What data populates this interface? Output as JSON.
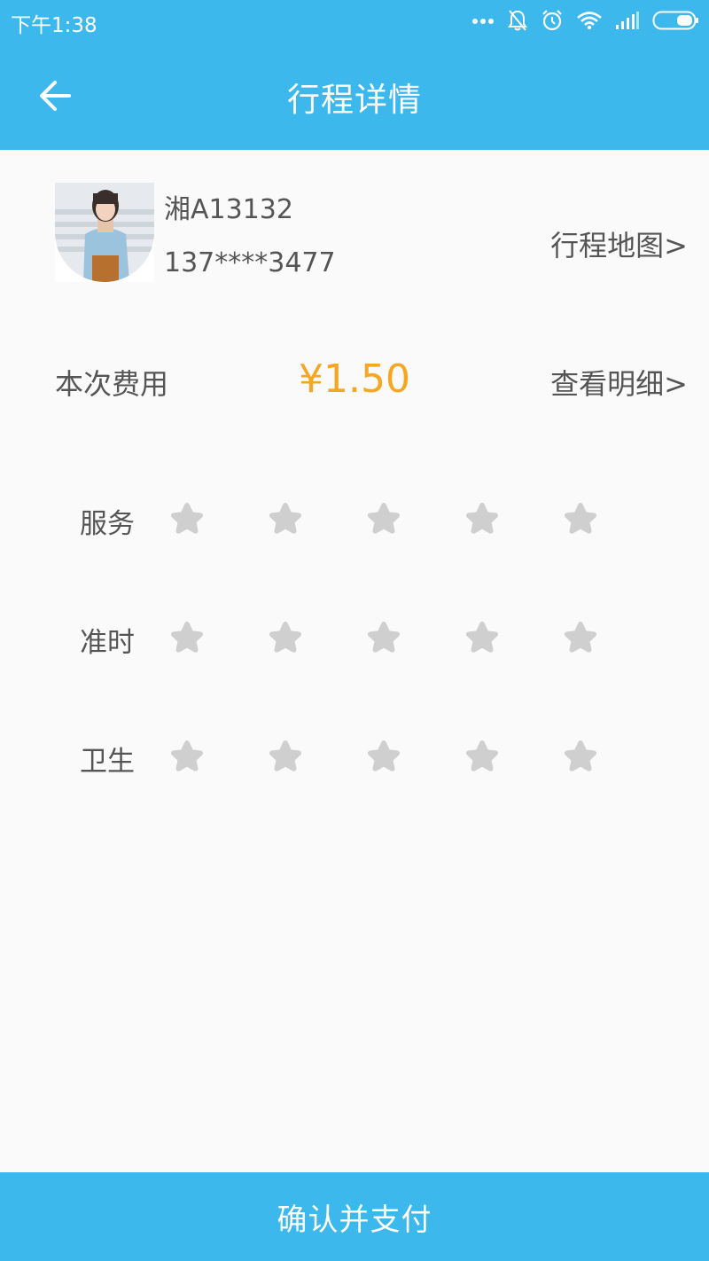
{
  "status_bar": {
    "time": "下午1:38",
    "icons": [
      "more-dots-icon",
      "bell-off-icon",
      "alarm-icon",
      "wifi-icon",
      "signal-icon",
      "battery-icon"
    ]
  },
  "header": {
    "title": "行程详情",
    "back_icon": "arrow-left-icon",
    "background_color": "#3cb8ec"
  },
  "driver": {
    "plate": "湘A13132",
    "phone": "137****3477",
    "map_link": "行程地图>"
  },
  "fee": {
    "label": "本次费用",
    "amount": "¥1.50",
    "amount_color": "#f5a623",
    "detail_link": "查看明细>"
  },
  "ratings": [
    {
      "label": "服务",
      "stars_filled": 0,
      "stars_total": 5
    },
    {
      "label": "准时",
      "stars_filled": 0,
      "stars_total": 5
    },
    {
      "label": "卫生",
      "stars_filled": 0,
      "stars_total": 5
    }
  ],
  "star_color_empty": "#cfcfcf",
  "footer": {
    "pay_button": "确认并支付"
  }
}
